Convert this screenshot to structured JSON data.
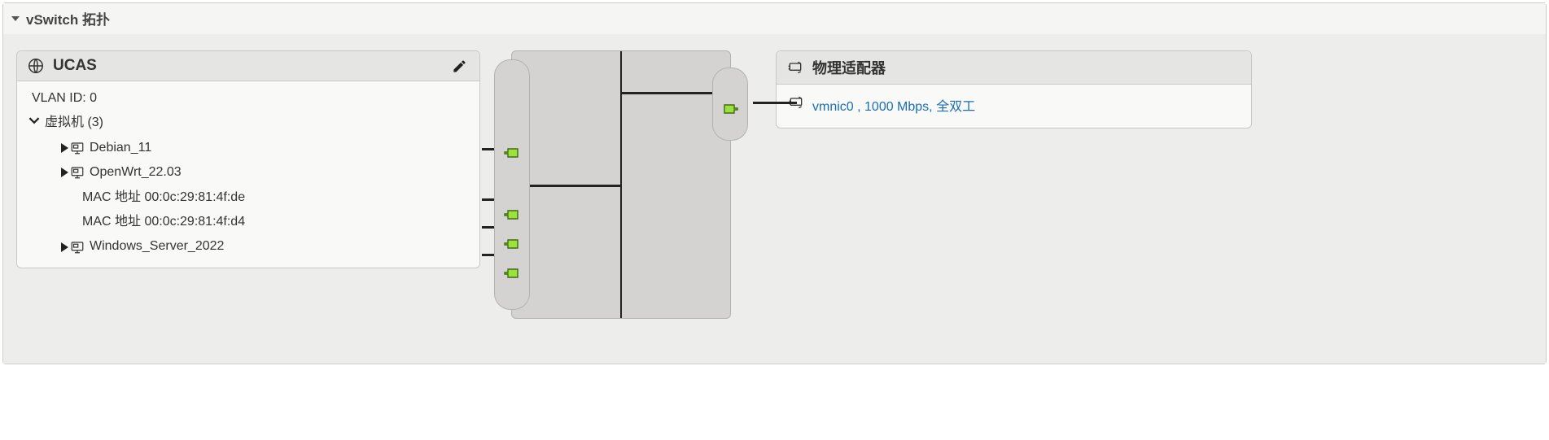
{
  "panel": {
    "title": "vSwitch 拓扑"
  },
  "portGroup": {
    "name": "UCAS",
    "vlan_label": "VLAN ID: 0",
    "vm_header": "虚拟机 (3)",
    "vms": [
      {
        "name": "Debian_11",
        "expanded": false,
        "macs": []
      },
      {
        "name": "OpenWrt_22.03",
        "expanded": true,
        "macs": [
          "MAC 地址 00:0c:29:81:4f:de",
          "MAC 地址 00:0c:29:81:4f:d4"
        ]
      },
      {
        "name": "Windows_Server_2022",
        "expanded": false,
        "macs": []
      }
    ]
  },
  "physical": {
    "title": "物理适配器",
    "nics": [
      {
        "label": "vmnic0 , 1000 Mbps, 全双工"
      }
    ]
  }
}
